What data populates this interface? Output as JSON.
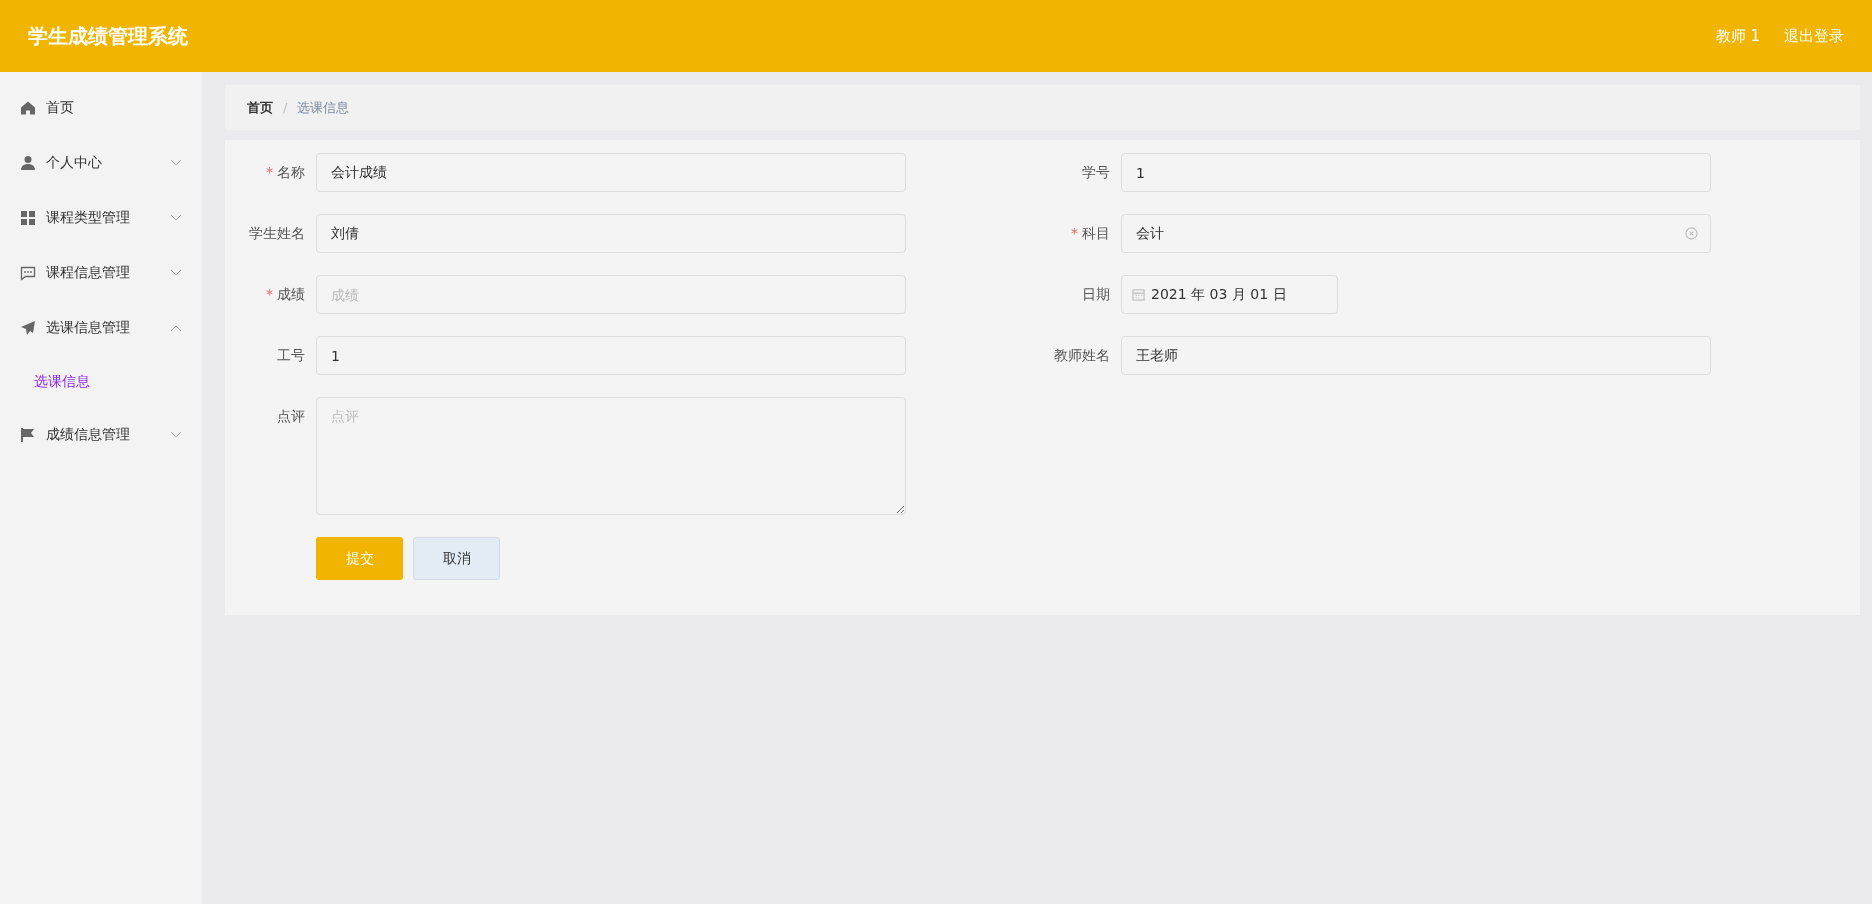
{
  "header": {
    "title": "学生成绩管理系统",
    "user": "教师 1",
    "logout": "退出登录"
  },
  "sidebar": {
    "items": [
      {
        "label": "首页",
        "kind": "link"
      },
      {
        "label": "个人中心",
        "kind": "menu",
        "expanded": false
      },
      {
        "label": "课程类型管理",
        "kind": "menu",
        "expanded": false
      },
      {
        "label": "课程信息管理",
        "kind": "menu",
        "expanded": false
      },
      {
        "label": "选课信息管理",
        "kind": "menu",
        "expanded": true,
        "children": [
          {
            "label": "选课信息",
            "selected": true
          }
        ]
      },
      {
        "label": "成绩信息管理",
        "kind": "menu",
        "expanded": false
      }
    ]
  },
  "breadcrumb": {
    "separator": "/",
    "items": [
      {
        "label": "首页",
        "current": false
      },
      {
        "label": "选课信息",
        "current": true
      }
    ]
  },
  "form": {
    "required_mark": "*",
    "fields": [
      {
        "label": "名称",
        "required": true,
        "kind": "text",
        "value": "会计成绩"
      },
      {
        "label": "学号",
        "required": false,
        "kind": "text",
        "value": "1"
      },
      {
        "label": "学生姓名",
        "required": false,
        "kind": "text",
        "value": "刘倩"
      },
      {
        "label": "科目",
        "required": true,
        "kind": "select",
        "value": "会计"
      },
      {
        "label": "成绩",
        "required": true,
        "kind": "text",
        "placeholder": "成绩"
      },
      {
        "label": "日期",
        "required": false,
        "kind": "date",
        "value": "2021 年 03 月 01 日"
      },
      {
        "label": "工号",
        "required": false,
        "kind": "text",
        "value": "1"
      },
      {
        "label": "教师姓名",
        "required": false,
        "kind": "text",
        "value": "王老师"
      },
      {
        "label": "点评",
        "required": false,
        "kind": "textarea",
        "placeholder": "点评"
      }
    ],
    "buttons": [
      {
        "label": "提交",
        "kind": "primary"
      },
      {
        "label": "取消",
        "kind": "secondary"
      }
    ]
  }
}
